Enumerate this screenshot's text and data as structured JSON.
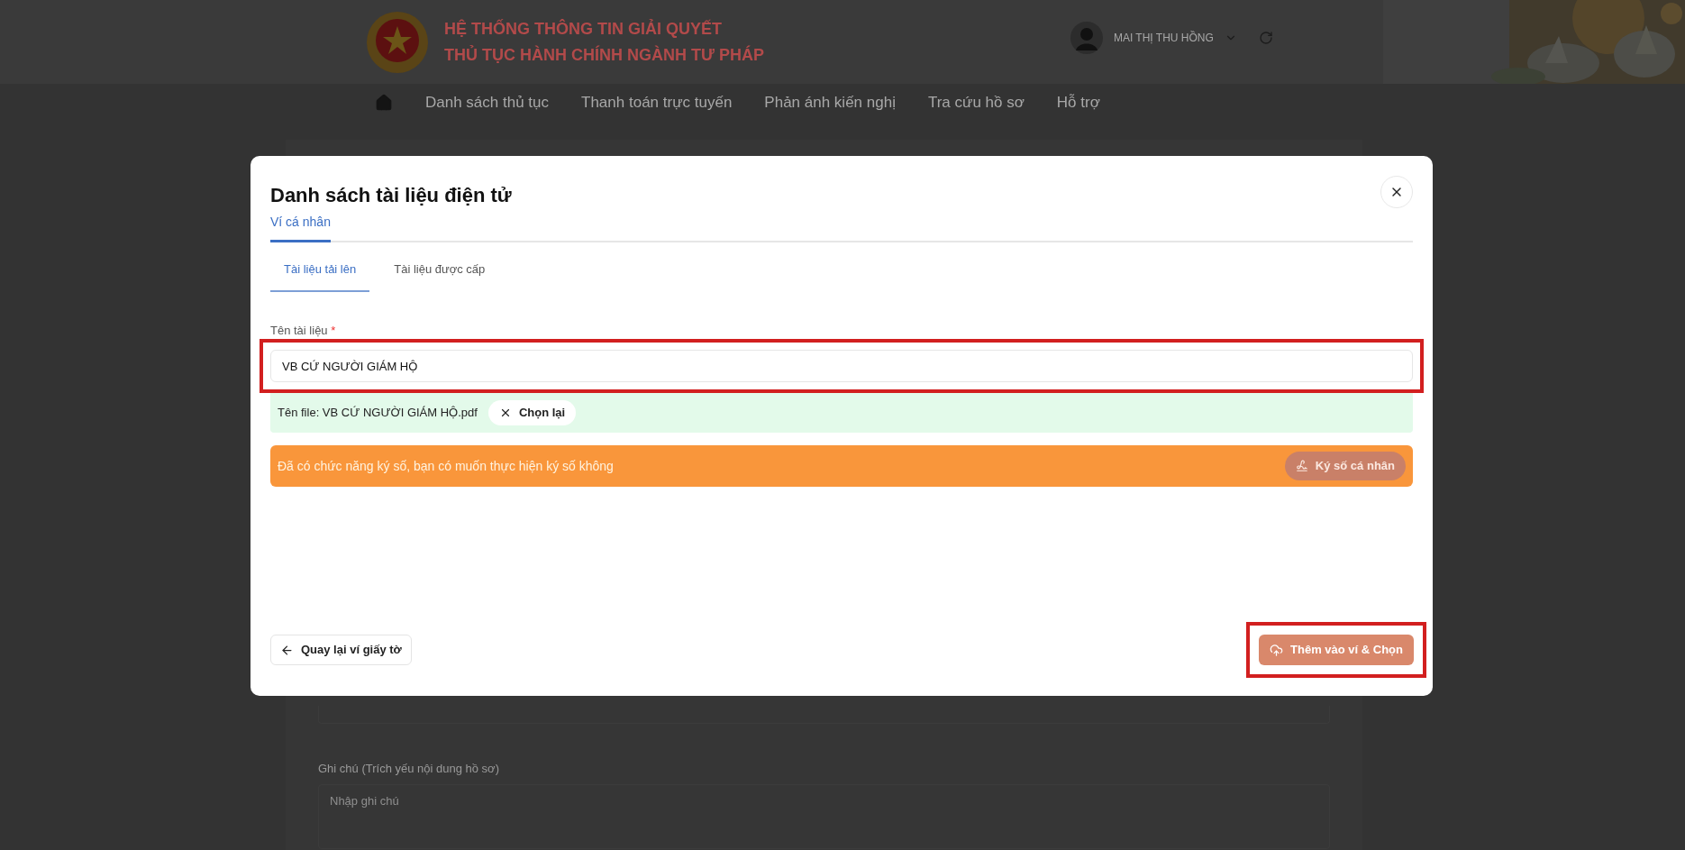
{
  "header": {
    "title_lines": [
      "HỆ THỐNG THÔNG TIN GIẢI QUYẾT",
      "THỦ TỤC HÀNH CHÍNH NGÀNH TƯ PHÁP"
    ],
    "user": "MAI THỊ THU HỒNG"
  },
  "nav": [
    {
      "label": "Danh sách thủ tục"
    },
    {
      "label": "Thanh toán trực tuyến"
    },
    {
      "label": "Phản ánh kiến nghị"
    },
    {
      "label": "Tra cứu hồ sơ"
    },
    {
      "label": "Hỗ trợ"
    }
  ],
  "background_form": {
    "notes_label": "Ghi chú (Trích yếu nội dung hồ sơ)",
    "notes_placeholder": "Nhập ghi chú"
  },
  "dialog": {
    "title": "Danh sách tài liệu điện tử",
    "tabs": [
      {
        "label": "Ví cá nhân",
        "selected": true
      }
    ],
    "subtabs": [
      {
        "label": "Tài liệu tải lên",
        "selected": true
      },
      {
        "label": "Tài liệu được cấp",
        "selected": false
      }
    ],
    "field": {
      "label": "Tên tài liệu",
      "required_mark": "*",
      "value": "VB CỨ NGƯỜI GIÁM HỘ",
      "highlighted": true
    },
    "file": {
      "text": "Tên file: VB CỨ NGƯỜI GIÁM HỘ.pdf",
      "button": "Chọn lại"
    },
    "sign_banner": {
      "text": "Đã có chức năng ký số, bạn có muốn thực hiện ký số không",
      "button": "Ký số cá nhân"
    },
    "back_button": "Quay lại ví giấy tờ",
    "add_button": {
      "label": "Thêm vào ví & Chọn",
      "highlighted": true
    }
  }
}
